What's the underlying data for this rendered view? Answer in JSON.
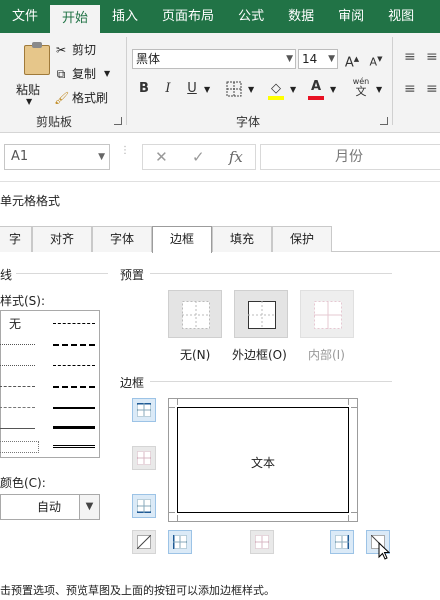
{
  "ribbon": {
    "tabs": [
      "文件",
      "开始",
      "插入",
      "页面布局",
      "公式",
      "数据",
      "审阅",
      "视图"
    ],
    "active_tab": "开始",
    "clipboard": {
      "paste": "粘贴",
      "cut": "剪切",
      "copy": "复制",
      "format_painter": "格式刷",
      "group_label": "剪贴板"
    },
    "font": {
      "font_name": "黑体",
      "font_size": "14",
      "grow": "A",
      "shrink": "A",
      "bold": "B",
      "italic": "I",
      "underline": "U",
      "font_color_letter": "A",
      "pinyin": "wén",
      "group_label": "字体"
    }
  },
  "formula_bar": {
    "name_box": "A1",
    "cancel": "✕",
    "enter": "✓",
    "fx": "fx",
    "content": "月份"
  },
  "dialog": {
    "title": "单元格格式",
    "tabs": [
      "字",
      "对齐",
      "字体",
      "边框",
      "填充",
      "保护"
    ],
    "active_tab": "边框",
    "line_section": "线",
    "style_label": "样式(S):",
    "style_none": "无",
    "color_label": "颜色(C):",
    "color_value": "自动",
    "presets_label": "预置",
    "preset_none": "无(N)",
    "preset_outline": "外边框(O)",
    "preset_inside": "内部(I)",
    "border_label": "边框",
    "preview_text": "文本",
    "hint": "击预置选项、预览草图及上面的按钮可以添加边框样式。"
  },
  "colors": {
    "excel_green": "#217346",
    "ribbon_bg": "#f3f3f3",
    "button_blue": "#dbeaf7",
    "font_red": "#e81123",
    "highlight_yellow": "#ffff00"
  }
}
